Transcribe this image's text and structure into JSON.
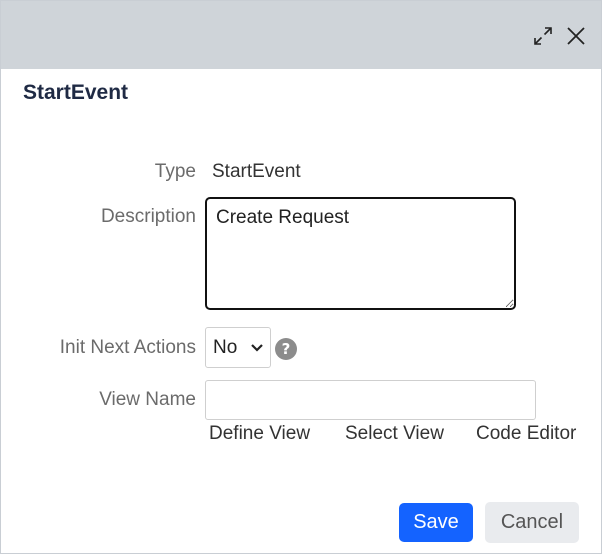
{
  "dialog": {
    "title": "StartEvent",
    "titlebar_icons": [
      "expand-icon",
      "close-icon"
    ]
  },
  "form": {
    "type": {
      "label": "Type",
      "value": "StartEvent"
    },
    "description": {
      "label": "Description",
      "value": "Create Request"
    },
    "init_next_actions": {
      "label": "Init Next Actions",
      "selected": "No"
    },
    "view_name": {
      "label": "View Name",
      "value": ""
    }
  },
  "view_links": {
    "define": "Define View",
    "select": "Select View",
    "code": "Code Editor"
  },
  "buttons": {
    "save": "Save",
    "cancel": "Cancel"
  },
  "colors": {
    "titlebar": "#cfd4d9",
    "primary": "#1463ff",
    "secondary": "#e9ebee",
    "title_text": "#1f2a44"
  }
}
